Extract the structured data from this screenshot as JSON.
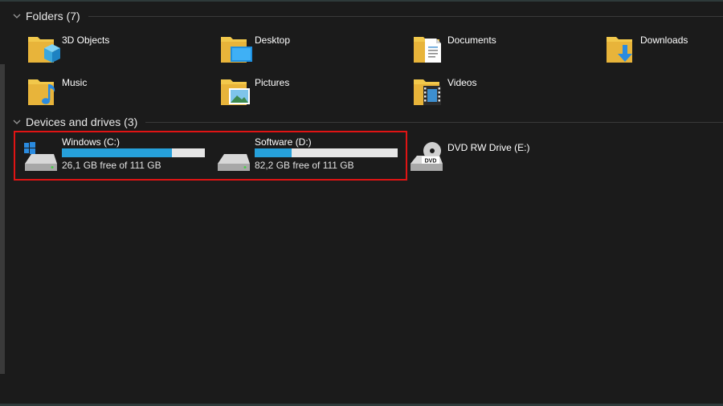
{
  "sections": {
    "folders_title": "Folders (7)",
    "devices_title": "Devices and drives (3)"
  },
  "folders": [
    {
      "label": "3D Objects",
      "icon": "3d-objects-folder-icon"
    },
    {
      "label": "Desktop",
      "icon": "desktop-folder-icon"
    },
    {
      "label": "Documents",
      "icon": "documents-folder-icon"
    },
    {
      "label": "Downloads",
      "icon": "downloads-folder-icon"
    },
    {
      "label": "Music",
      "icon": "music-folder-icon"
    },
    {
      "label": "Pictures",
      "icon": "pictures-folder-icon"
    },
    {
      "label": "Videos",
      "icon": "videos-folder-icon"
    }
  ],
  "drives": [
    {
      "name": "Windows (C:)",
      "free_text": "26,1 GB free of 111 GB",
      "used_fraction": 0.77,
      "icon": "windows-drive-icon"
    },
    {
      "name": "Software (D:)",
      "free_text": "82,2 GB free of 111 GB",
      "used_fraction": 0.26,
      "icon": "hard-drive-icon"
    },
    {
      "name": "DVD RW Drive (E:)",
      "icon": "dvd-drive-icon"
    }
  ],
  "colors": {
    "background": "#1b1b1b",
    "bar_fill": "#26a0da",
    "bar_track": "#e6e6e6",
    "highlight": "#e01414",
    "folder_yellow": "#f2c84b"
  }
}
